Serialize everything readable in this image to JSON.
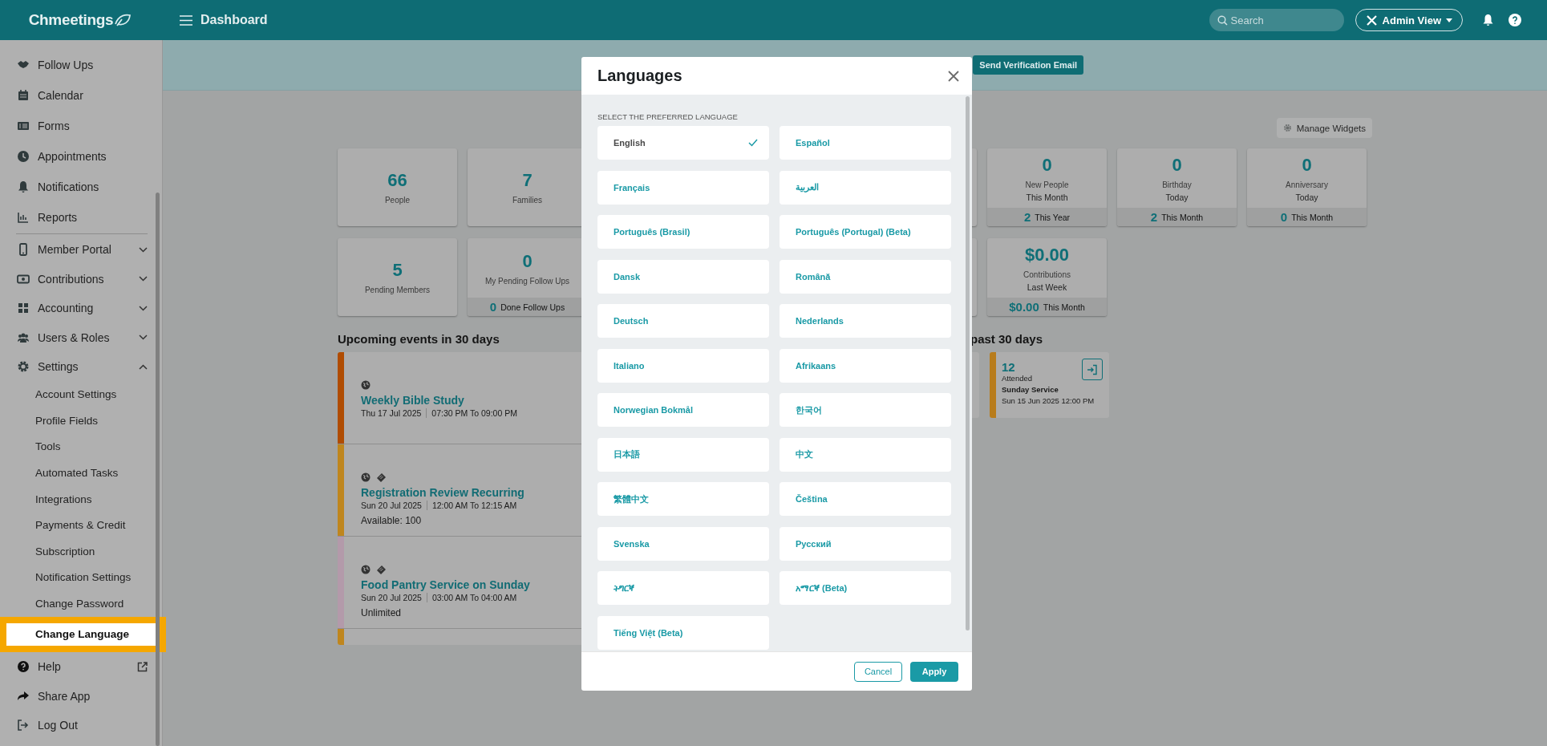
{
  "header": {
    "logo": "Chmeetings",
    "title": "Dashboard",
    "search_placeholder": "Search",
    "view_button": "Admin View"
  },
  "sidebar": {
    "items": [
      {
        "label": "Follow Ups"
      },
      {
        "label": "Calendar"
      },
      {
        "label": "Forms"
      },
      {
        "label": "Appointments"
      },
      {
        "label": "Notifications"
      },
      {
        "label": "Reports",
        "divider_after": true
      },
      {
        "label": "Member Portal",
        "expandable": true,
        "expanded": false
      },
      {
        "label": "Contributions",
        "expandable": true,
        "expanded": false
      },
      {
        "label": "Accounting",
        "expandable": true,
        "expanded": false
      },
      {
        "label": "Users & Roles",
        "expandable": true,
        "expanded": false
      },
      {
        "label": "Settings",
        "expandable": true,
        "expanded": true,
        "children": [
          {
            "label": "Account Settings",
            "selected": false
          },
          {
            "label": "Profile Fields",
            "selected": false
          },
          {
            "label": "Tools",
            "selected": false
          },
          {
            "label": "Automated Tasks",
            "selected": false
          },
          {
            "label": "Integrations",
            "selected": false
          },
          {
            "label": "Payments & Credit",
            "selected": false
          },
          {
            "label": "Subscription",
            "selected": false
          },
          {
            "label": "Notification Settings",
            "selected": false
          },
          {
            "label": "Change Password",
            "selected": false
          },
          {
            "label": "Change Language",
            "selected": true
          }
        ]
      },
      {
        "label": "Help",
        "external": true
      },
      {
        "label": "Share App"
      },
      {
        "label": "Log Out"
      }
    ]
  },
  "banner": {
    "button": "Send Verification Email"
  },
  "manage_widgets": "Manage Widgets",
  "stat_rows": [
    {
      "left": [
        {
          "value": "66",
          "label": "People"
        },
        {
          "value": "7",
          "label": "Families"
        }
      ],
      "right": [
        {
          "value": "0",
          "label": "New People",
          "sublabel": "This Month",
          "footer_value": "2",
          "footer_label": "This Year"
        },
        {
          "value": "0",
          "label": "Birthday",
          "sublabel": "Today",
          "footer_value": "2",
          "footer_label": "This Month"
        },
        {
          "value": "0",
          "label": "Anniversary",
          "sublabel": "Today",
          "footer_value": "0",
          "footer_label": "This Month"
        }
      ]
    },
    {
      "left": [
        {
          "value": "5",
          "label": "Pending Members"
        },
        {
          "value": "0",
          "label": "My Pending Follow Ups",
          "footer_value": "0",
          "footer_label": "Done Follow Ups"
        }
      ],
      "right": [
        {
          "value": "$0.00",
          "label": "Contributions",
          "sublabel": "Last Week",
          "footer_value": "$0.00",
          "footer_label": "This Month"
        }
      ]
    }
  ],
  "upcoming": {
    "title": "Upcoming events in 30 days",
    "events": [
      {
        "color": "#b04c02",
        "globe": true,
        "ticket": false,
        "name": "Weekly Bible Study",
        "date": "Thu 17 Jul  2025",
        "time": "07:30 PM To 09:00 PM"
      },
      {
        "color": "#bf861e",
        "globe": true,
        "ticket": true,
        "name": "Registration Review Recurring",
        "date": "Sun 20 Jul  2025",
        "time": "12:00 AM To 12:15 AM",
        "note": "Available: 100"
      },
      {
        "color": "#b39aaa",
        "globe": true,
        "ticket": true,
        "name": "Food Pantry Service on Sunday",
        "date": "Sun 20 Jul  2025",
        "time": "03:00 AM To 04:00 AM",
        "note": "Unlimited"
      },
      {
        "color": "#bf861e"
      }
    ]
  },
  "attendance": {
    "title": "past 30 days",
    "cards": [
      {
        "color": "#b87c1c",
        "count": "12",
        "label": "Attended",
        "name": "Sunday Service",
        "datetime": "Sun 15 Jun 2025 12:00 PM"
      }
    ]
  },
  "modal": {
    "title": "Languages",
    "section_label": "SELECT THE PREFERRED LANGUAGE",
    "languages": [
      {
        "label": "English",
        "selected": true
      },
      {
        "label": "Español",
        "selected": false
      },
      {
        "label": "Français",
        "selected": false
      },
      {
        "label": "العربية",
        "selected": false
      },
      {
        "label": "Português (Brasil)",
        "selected": false
      },
      {
        "label": "Português (Portugal) (Beta)",
        "selected": false
      },
      {
        "label": "Dansk",
        "selected": false
      },
      {
        "label": "Română",
        "selected": false
      },
      {
        "label": "Deutsch",
        "selected": false
      },
      {
        "label": "Nederlands",
        "selected": false
      },
      {
        "label": "Italiano",
        "selected": false
      },
      {
        "label": "Afrikaans",
        "selected": false
      },
      {
        "label": "Norwegian Bokmål",
        "selected": false
      },
      {
        "label": "한국어",
        "selected": false
      },
      {
        "label": "日本語",
        "selected": false
      },
      {
        "label": "中文",
        "selected": false
      },
      {
        "label": "繁體中文",
        "selected": false
      },
      {
        "label": "Čeština",
        "selected": false
      },
      {
        "label": "Svenska",
        "selected": false
      },
      {
        "label": "Русский",
        "selected": false
      },
      {
        "label": "ትግርኛ",
        "selected": false
      },
      {
        "label": "አማርኛ (Beta)",
        "selected": false
      },
      {
        "label": "Tiếng Việt (Beta)",
        "selected": false
      }
    ],
    "cancel": "Cancel",
    "apply": "Apply"
  }
}
